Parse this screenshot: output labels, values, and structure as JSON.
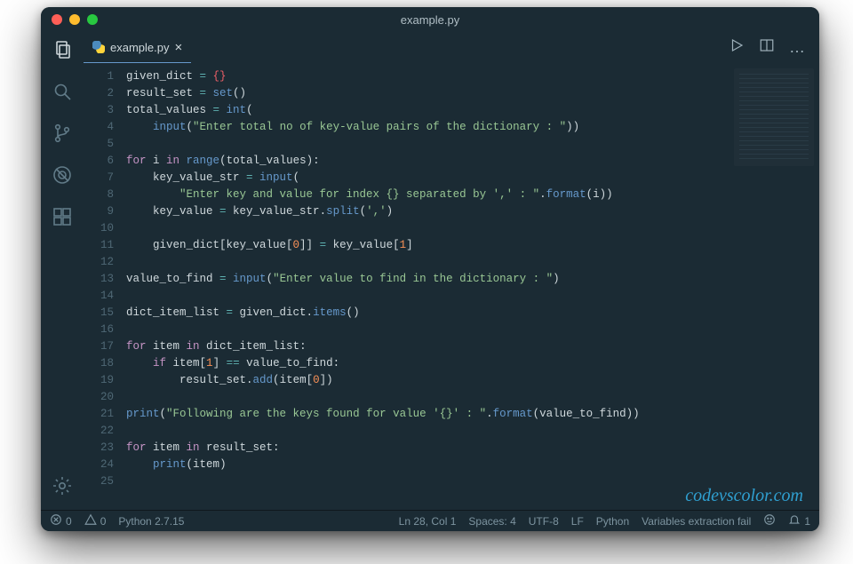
{
  "window": {
    "title": "example.py"
  },
  "traffic": {
    "close": "#ff5f57",
    "min": "#febc2e",
    "max": "#28c840"
  },
  "tab": {
    "filename": "example.py",
    "close_glyph": "×"
  },
  "tab_actions": {
    "run": "run-icon",
    "split": "split-editor-icon",
    "more": "…"
  },
  "activity": {
    "items": [
      {
        "id": "explorer",
        "active": true
      },
      {
        "id": "search",
        "active": false
      },
      {
        "id": "scm",
        "active": false
      },
      {
        "id": "debug",
        "active": false
      },
      {
        "id": "extensions",
        "active": false
      }
    ],
    "gear": "settings-gear"
  },
  "gutter_start": 1,
  "code_lines": [
    [
      [
        "given_dict ",
        "p"
      ],
      [
        "= ",
        "op"
      ],
      [
        "{}",
        "b"
      ]
    ],
    [
      [
        "result_set ",
        "p"
      ],
      [
        "= ",
        "op"
      ],
      [
        "set",
        "fn"
      ],
      [
        "()",
        "p"
      ]
    ],
    [
      [
        "total_values ",
        "p"
      ],
      [
        "= ",
        "op"
      ],
      [
        "int",
        "fn"
      ],
      [
        "(",
        "p"
      ]
    ],
    [
      [
        "    ",
        "p"
      ],
      [
        "input",
        "fn"
      ],
      [
        "(",
        "p"
      ],
      [
        "\"Enter total no of key-value pairs of the dictionary : \"",
        "s"
      ],
      [
        "))",
        "p"
      ]
    ],
    [],
    [
      [
        "for ",
        "k"
      ],
      [
        "i ",
        "p"
      ],
      [
        "in ",
        "k"
      ],
      [
        "range",
        "fn"
      ],
      [
        "(",
        "p"
      ],
      [
        "total_values",
        "p"
      ],
      [
        "):",
        "p"
      ]
    ],
    [
      [
        "    key_value_str ",
        "p"
      ],
      [
        "= ",
        "op"
      ],
      [
        "input",
        "fn"
      ],
      [
        "(",
        "p"
      ]
    ],
    [
      [
        "        ",
        "p"
      ],
      [
        "\"Enter key and value for index {} separated by ',' : \"",
        "s"
      ],
      [
        ".",
        "p"
      ],
      [
        "format",
        "fn"
      ],
      [
        "(",
        "p"
      ],
      [
        "i",
        "p"
      ],
      [
        "))",
        "p"
      ]
    ],
    [
      [
        "    key_value ",
        "p"
      ],
      [
        "= ",
        "op"
      ],
      [
        "key_value_str.",
        "p"
      ],
      [
        "split",
        "fn"
      ],
      [
        "(",
        "p"
      ],
      [
        "','",
        "s"
      ],
      [
        ")",
        "p"
      ]
    ],
    [],
    [
      [
        "    given_dict[key_value[",
        "p"
      ],
      [
        "0",
        "n"
      ],
      [
        "]] ",
        "p"
      ],
      [
        "= ",
        "op"
      ],
      [
        "key_value[",
        "p"
      ],
      [
        "1",
        "n"
      ],
      [
        "]",
        "p"
      ]
    ],
    [],
    [
      [
        "value_to_find ",
        "p"
      ],
      [
        "= ",
        "op"
      ],
      [
        "input",
        "fn"
      ],
      [
        "(",
        "p"
      ],
      [
        "\"Enter value to find in the dictionary : \"",
        "s"
      ],
      [
        ")",
        "p"
      ]
    ],
    [],
    [
      [
        "dict_item_list ",
        "p"
      ],
      [
        "= ",
        "op"
      ],
      [
        "given_dict.",
        "p"
      ],
      [
        "items",
        "fn"
      ],
      [
        "()",
        "p"
      ]
    ],
    [],
    [
      [
        "for ",
        "k"
      ],
      [
        "item ",
        "p"
      ],
      [
        "in ",
        "k"
      ],
      [
        "dict_item_list:",
        "p"
      ]
    ],
    [
      [
        "    ",
        "p"
      ],
      [
        "if ",
        "k"
      ],
      [
        "item[",
        "p"
      ],
      [
        "1",
        "n"
      ],
      [
        "] ",
        "p"
      ],
      [
        "== ",
        "op"
      ],
      [
        "value_to_find:",
        "p"
      ]
    ],
    [
      [
        "        result_set.",
        "p"
      ],
      [
        "add",
        "fn"
      ],
      [
        "(",
        "p"
      ],
      [
        "item[",
        "p"
      ],
      [
        "0",
        "n"
      ],
      [
        "])",
        "p"
      ]
    ],
    [],
    [
      [
        "print",
        "fn"
      ],
      [
        "(",
        "p"
      ],
      [
        "\"Following are the keys found for value '{}' : \"",
        "s"
      ],
      [
        ".",
        "p"
      ],
      [
        "format",
        "fn"
      ],
      [
        "(",
        "p"
      ],
      [
        "value_to_find",
        "p"
      ],
      [
        "))",
        "p"
      ]
    ],
    [],
    [
      [
        "for ",
        "k"
      ],
      [
        "item ",
        "p"
      ],
      [
        "in ",
        "k"
      ],
      [
        "result_set:",
        "p"
      ]
    ],
    [
      [
        "    ",
        "p"
      ],
      [
        "print",
        "fn"
      ],
      [
        "(",
        "p"
      ],
      [
        "item",
        "p"
      ],
      [
        ")",
        "p"
      ]
    ],
    []
  ],
  "status": {
    "errors": "0",
    "warnings": "0",
    "python": "Python 2.7.15",
    "caret": "Ln 28, Col 1",
    "indent": "Spaces: 4",
    "encoding": "UTF-8",
    "eol": "LF",
    "language": "Python",
    "vars": "Variables extraction fail",
    "bell": "1"
  },
  "watermark": "codevscolor.com"
}
